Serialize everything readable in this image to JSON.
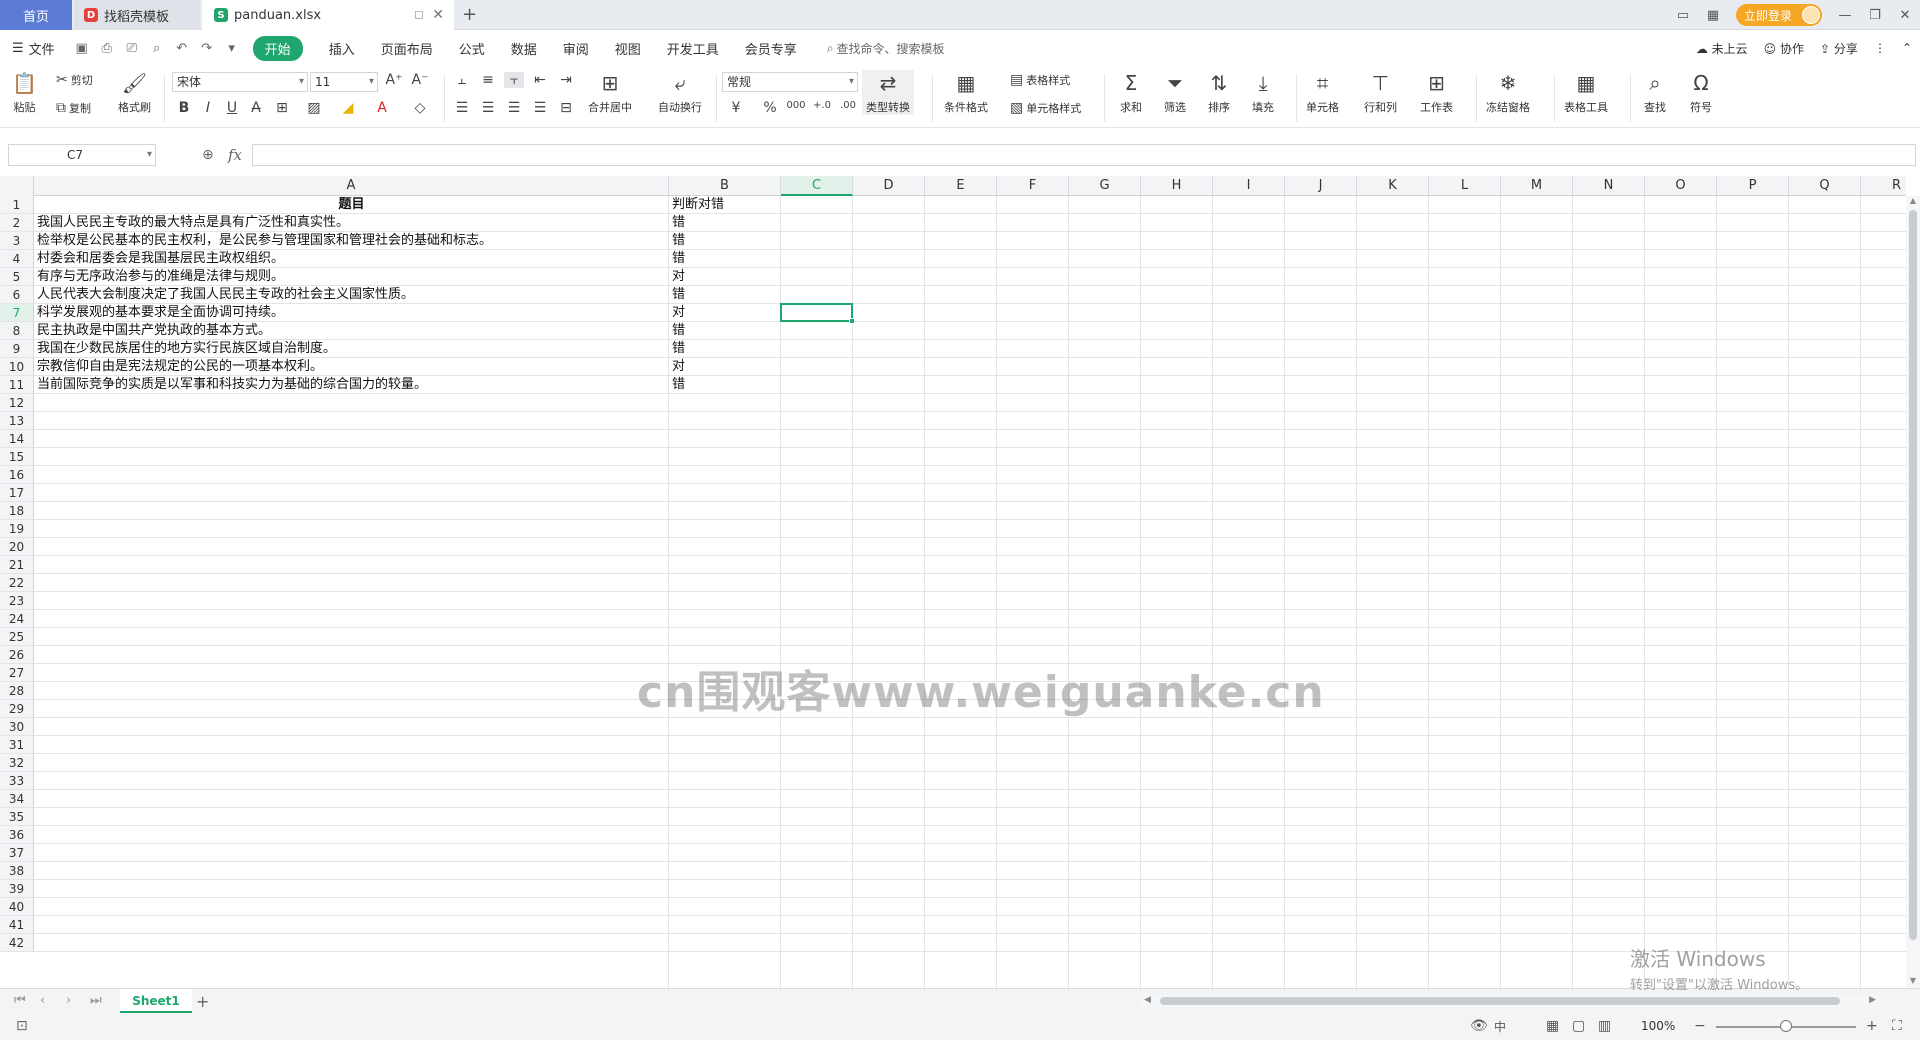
{
  "tabs": {
    "home": "首页",
    "template": "找稻壳模板",
    "file": "panduan.xlsx",
    "add": "+"
  },
  "window": {
    "login": "立即登录"
  },
  "menu": {
    "file": "文件",
    "items": [
      "开始",
      "插入",
      "页面布局",
      "公式",
      "数据",
      "审阅",
      "视图",
      "开发工具",
      "会员专享"
    ],
    "search": "查找命令、搜索模板",
    "cloud": "未上云",
    "collab": "协作",
    "share": "分享"
  },
  "ribbon": {
    "paste": "粘贴",
    "cut": "剪切",
    "copy": "复制",
    "format_painter": "格式刷",
    "font_name": "宋体",
    "font_size": "11",
    "merge": "合并居中",
    "wrap": "自动换行",
    "number_format": "常规",
    "type_convert": "类型转换",
    "cond_format": "条件格式",
    "table_style": "表格样式",
    "cell_style": "单元格样式",
    "sum": "求和",
    "filter": "筛选",
    "sort": "排序",
    "fill": "填充",
    "cell": "单元格",
    "rowcol": "行和列",
    "worksheet": "工作表",
    "freeze": "冻结窗格",
    "table_tools": "表格工具",
    "find": "查找",
    "symbol": "符号"
  },
  "formula": {
    "name_box": "C7",
    "fx": "fx",
    "value": ""
  },
  "grid": {
    "columns": [
      "A",
      "B",
      "C",
      "D",
      "E",
      "F",
      "G",
      "H",
      "I",
      "J",
      "K",
      "L",
      "M",
      "N",
      "O",
      "P",
      "Q",
      "R"
    ],
    "selected_column": "C",
    "selected_row": 7,
    "header_row": {
      "a": "题目",
      "b": "判断对错"
    },
    "rows": [
      {
        "a": "我国人民民主专政的最大特点是具有广泛性和真实性。",
        "b": "错"
      },
      {
        "a": "检举权是公民基本的民主权利，是公民参与管理国家和管理社会的基础和标志。",
        "b": "错"
      },
      {
        "a": "村委会和居委会是我国基层民主政权组织。",
        "b": "错"
      },
      {
        "a": "有序与无序政治参与的准绳是法律与规则。",
        "b": "对"
      },
      {
        "a": "人民代表大会制度决定了我国人民民主专政的社会主义国家性质。",
        "b": "错"
      },
      {
        "a": "科学发展观的基本要求是全面协调可持续。",
        "b": "对"
      },
      {
        "a": "民主执政是中国共产党执政的基本方式。",
        "b": "错"
      },
      {
        "a": "我国在少数民族居住的地方实行民族区域自治制度。",
        "b": "错"
      },
      {
        "a": "宗教信仰自由是宪法规定的公民的一项基本权利。",
        "b": "对"
      },
      {
        "a": "当前国际竞争的实质是以军事和科技实力为基础的综合国力的较量。",
        "b": "错"
      }
    ],
    "row_numbers": [
      "1",
      "2",
      "3",
      "4",
      "5",
      "6",
      "7",
      "8",
      "9",
      "10",
      "11",
      "12",
      "13",
      "14",
      "15",
      "16",
      "17",
      "18",
      "19",
      "20",
      "21",
      "22",
      "23",
      "24",
      "25",
      "26",
      "27",
      "28",
      "29",
      "30",
      "31",
      "32",
      "33",
      "34",
      "35",
      "36",
      "37",
      "38",
      "39",
      "40",
      "41",
      "42"
    ]
  },
  "watermark": "cn围观客www.weiguanke.cn",
  "sheets": {
    "active": "Sheet1",
    "add": "+"
  },
  "status": {
    "zoom": "100%"
  },
  "activation": {
    "title": "激活 Windows",
    "subtitle": "转到\"设置\"以激活 Windows。"
  },
  "colors": {
    "accent": "#1fa66d",
    "home_tab": "#5b7bd5",
    "login": "#f5a623"
  }
}
